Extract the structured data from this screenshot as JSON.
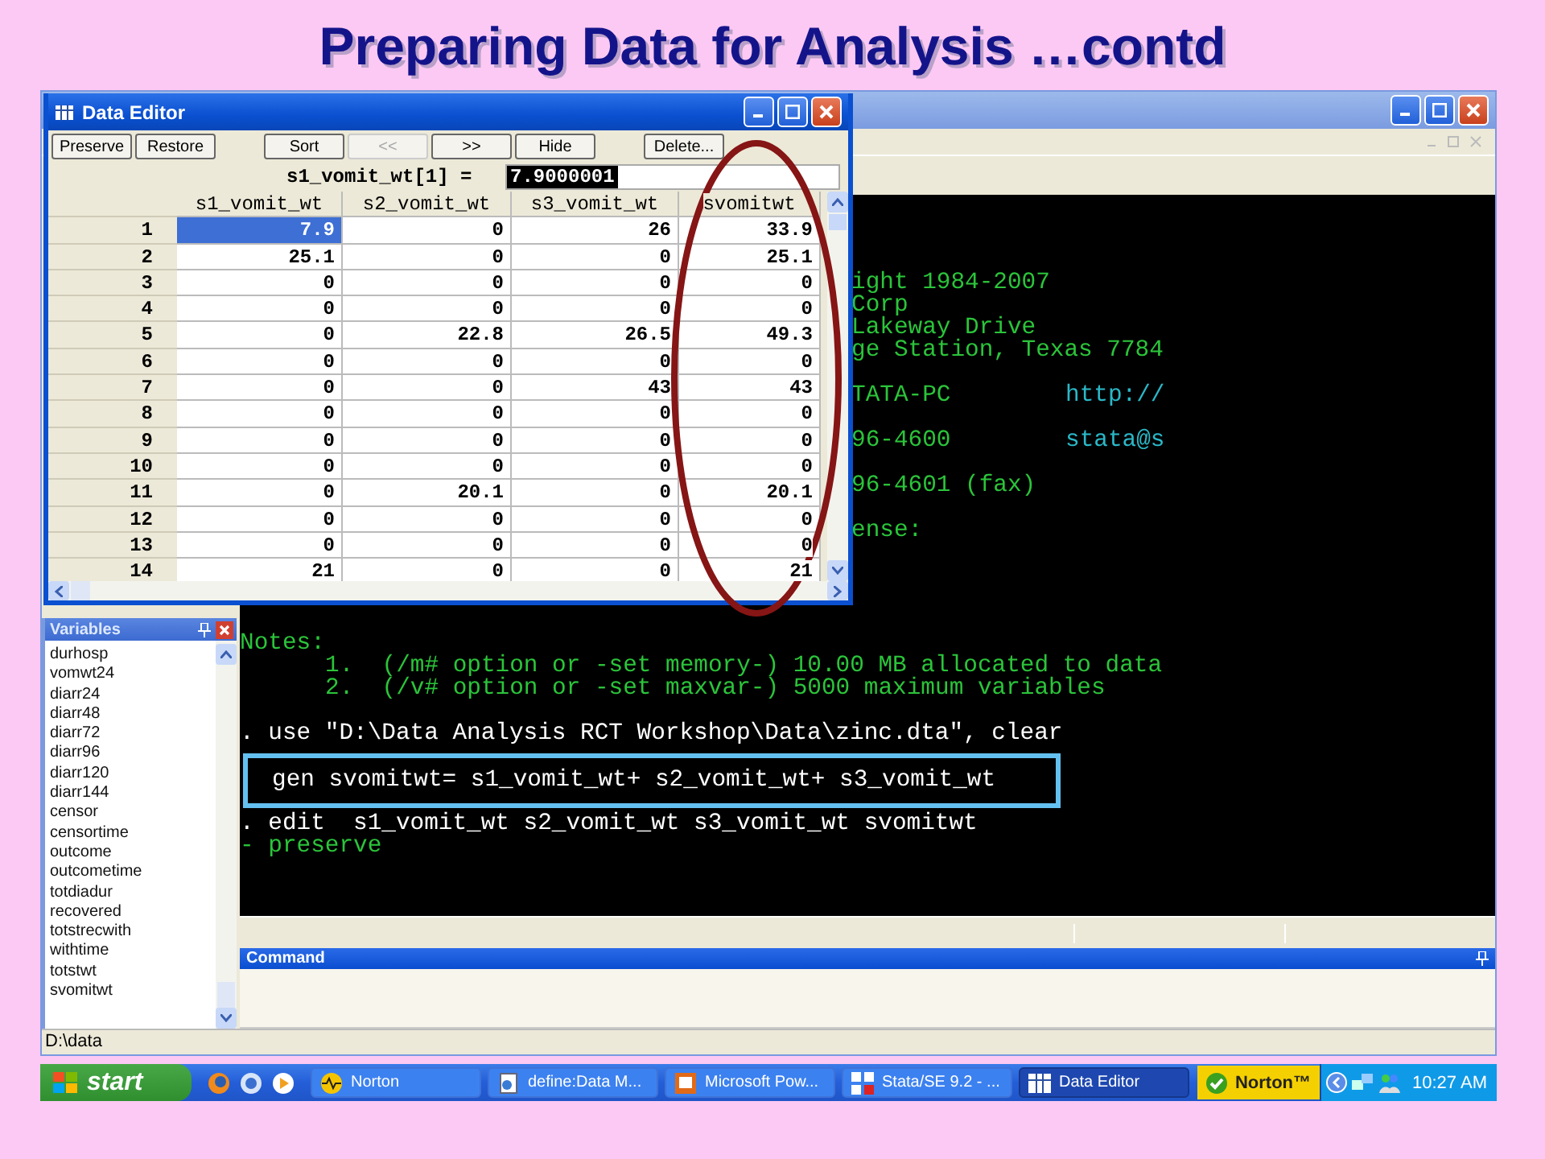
{
  "slide_title": "Preparing Data for Analysis …contd",
  "stata_window": {
    "results": {
      "lines": [
        {
          "kind": "blank"
        },
        {
          "kind": "blank"
        },
        {
          "kind": "blank"
        },
        {
          "kind": "banner",
          "text": "ight 1984-2007"
        },
        {
          "kind": "banner",
          "text": "Corp"
        },
        {
          "kind": "banner",
          "text": "Lakeway Drive"
        },
        {
          "kind": "banner",
          "text": "ge Station, Texas 7784"
        },
        {
          "kind": "blank"
        },
        {
          "kind": "banner",
          "text": "TATA-PC",
          "link": "http://"
        },
        {
          "kind": "blank"
        },
        {
          "kind": "banner",
          "text": "96-4600",
          "link": "stata@s"
        },
        {
          "kind": "blank"
        },
        {
          "kind": "banner",
          "text": "96-4601 (fax)"
        },
        {
          "kind": "blank"
        },
        {
          "kind": "banner",
          "text": "ense:"
        },
        {
          "kind": "blank"
        },
        {
          "kind": "blank"
        },
        {
          "kind": "blank"
        },
        {
          "kind": "blank"
        },
        {
          "kind": "note",
          "text": "Notes:"
        },
        {
          "kind": "note_item",
          "text": "1.  (/m# option or -set memory-) 10.00 MB allocated to data"
        },
        {
          "kind": "note_item",
          "text": "2.  (/v# option or -set maxvar-) 5000 maximum variables"
        },
        {
          "kind": "blank"
        },
        {
          "kind": "command",
          "text": ". use \"D:\\Data Analysis RCT Workshop\\Data\\zinc.dta\", clear"
        },
        {
          "kind": "highlighted",
          "text": "gen svomitwt= s1_vomit_wt+ s2_vomit_wt+ s3_vomit_wt"
        },
        {
          "kind": "command",
          "text": ". edit  s1_vomit_wt s2_vomit_wt s3_vomit_wt svomitwt"
        },
        {
          "kind": "output",
          "text": "- preserve"
        }
      ]
    },
    "command_panel": {
      "title": "Command"
    },
    "variables_panel": {
      "title": "Variables",
      "items": [
        "durhosp",
        "vomwt24",
        "diarr24",
        "diarr48",
        "diarr72",
        "diarr96",
        "diarr120",
        "diarr144",
        "censor",
        "censortime",
        "outcome",
        "outcometime",
        "totdiadur",
        "recovered",
        "totstrecwith",
        "withtime",
        "totstwt",
        "svomitwt"
      ]
    },
    "status_bar": "D:\\data"
  },
  "data_editor": {
    "title": "Data Editor",
    "buttons": [
      {
        "label": "Preserve",
        "disabled": false
      },
      {
        "label": "Restore",
        "disabled": false
      },
      {
        "label": "Sort",
        "disabled": false
      },
      {
        "label": "<<",
        "disabled": true
      },
      {
        "label": ">>",
        "disabled": false
      },
      {
        "label": "Hide",
        "disabled": false
      },
      {
        "label": "Delete...",
        "disabled": false
      }
    ],
    "cell_reference": "s1_vomit_wt[1] =",
    "cell_value": "7.9000001",
    "columns": [
      "s1_vomit_wt",
      "s2_vomit_wt",
      "s3_vomit_wt",
      "svomitwt"
    ],
    "rows": [
      {
        "label": "1",
        "cells": [
          {
            "value": "7.9",
            "selected": true
          },
          {
            "value": "0",
            "selected": false
          },
          {
            "value": "26",
            "selected": false
          },
          {
            "value": "33.9",
            "selected": false
          }
        ]
      },
      {
        "label": "2",
        "cells": [
          {
            "value": "25.1",
            "selected": false
          },
          {
            "value": "0",
            "selected": false
          },
          {
            "value": "0",
            "selected": false
          },
          {
            "value": "25.1",
            "selected": false
          }
        ]
      },
      {
        "label": "3",
        "cells": [
          {
            "value": "0",
            "selected": false
          },
          {
            "value": "0",
            "selected": false
          },
          {
            "value": "0",
            "selected": false
          },
          {
            "value": "0",
            "selected": false
          }
        ]
      },
      {
        "label": "4",
        "cells": [
          {
            "value": "0",
            "selected": false
          },
          {
            "value": "0",
            "selected": false
          },
          {
            "value": "0",
            "selected": false
          },
          {
            "value": "0",
            "selected": false
          }
        ]
      },
      {
        "label": "5",
        "cells": [
          {
            "value": "0",
            "selected": false
          },
          {
            "value": "22.8",
            "selected": false
          },
          {
            "value": "26.5",
            "selected": false
          },
          {
            "value": "49.3",
            "selected": false
          }
        ]
      },
      {
        "label": "6",
        "cells": [
          {
            "value": "0",
            "selected": false
          },
          {
            "value": "0",
            "selected": false
          },
          {
            "value": "0",
            "selected": false
          },
          {
            "value": "0",
            "selected": false
          }
        ]
      },
      {
        "label": "7",
        "cells": [
          {
            "value": "0",
            "selected": false
          },
          {
            "value": "0",
            "selected": false
          },
          {
            "value": "43",
            "selected": false
          },
          {
            "value": "43",
            "selected": false
          }
        ]
      },
      {
        "label": "8",
        "cells": [
          {
            "value": "0",
            "selected": false
          },
          {
            "value": "0",
            "selected": false
          },
          {
            "value": "0",
            "selected": false
          },
          {
            "value": "0",
            "selected": false
          }
        ]
      },
      {
        "label": "9",
        "cells": [
          {
            "value": "0",
            "selected": false
          },
          {
            "value": "0",
            "selected": false
          },
          {
            "value": "0",
            "selected": false
          },
          {
            "value": "0",
            "selected": false
          }
        ]
      },
      {
        "label": "10",
        "cells": [
          {
            "value": "0",
            "selected": false
          },
          {
            "value": "0",
            "selected": false
          },
          {
            "value": "0",
            "selected": false
          },
          {
            "value": "0",
            "selected": false
          }
        ]
      },
      {
        "label": "11",
        "cells": [
          {
            "value": "0",
            "selected": false
          },
          {
            "value": "20.1",
            "selected": false
          },
          {
            "value": "0",
            "selected": false
          },
          {
            "value": "20.1",
            "selected": false
          }
        ]
      },
      {
        "label": "12",
        "cells": [
          {
            "value": "0",
            "selected": false
          },
          {
            "value": "0",
            "selected": false
          },
          {
            "value": "0",
            "selected": false
          },
          {
            "value": "0",
            "selected": false
          }
        ]
      },
      {
        "label": "13",
        "cells": [
          {
            "value": "0",
            "selected": false
          },
          {
            "value": "0",
            "selected": false
          },
          {
            "value": "0",
            "selected": false
          },
          {
            "value": "0",
            "selected": false
          }
        ]
      },
      {
        "label": "14",
        "cells": [
          {
            "value": "21",
            "selected": false
          },
          {
            "value": "0",
            "selected": false
          },
          {
            "value": "0",
            "selected": false
          },
          {
            "value": "21",
            "selected": false
          }
        ]
      }
    ]
  },
  "taskbar": {
    "start": "start",
    "tasks": [
      {
        "kind": "norton",
        "label": "Norton",
        "selected": false
      },
      {
        "kind": "browser",
        "label": "define:Data M...",
        "selected": false
      },
      {
        "kind": "presentation",
        "label": "Microsoft Pow...",
        "selected": false
      },
      {
        "kind": "stata",
        "label": "Stata/SE 9.2 - ...",
        "selected": false
      },
      {
        "kind": "editor",
        "label": "Data Editor",
        "selected": true
      }
    ],
    "tray_badge": "Norton™",
    "clock": "10:27 AM"
  }
}
